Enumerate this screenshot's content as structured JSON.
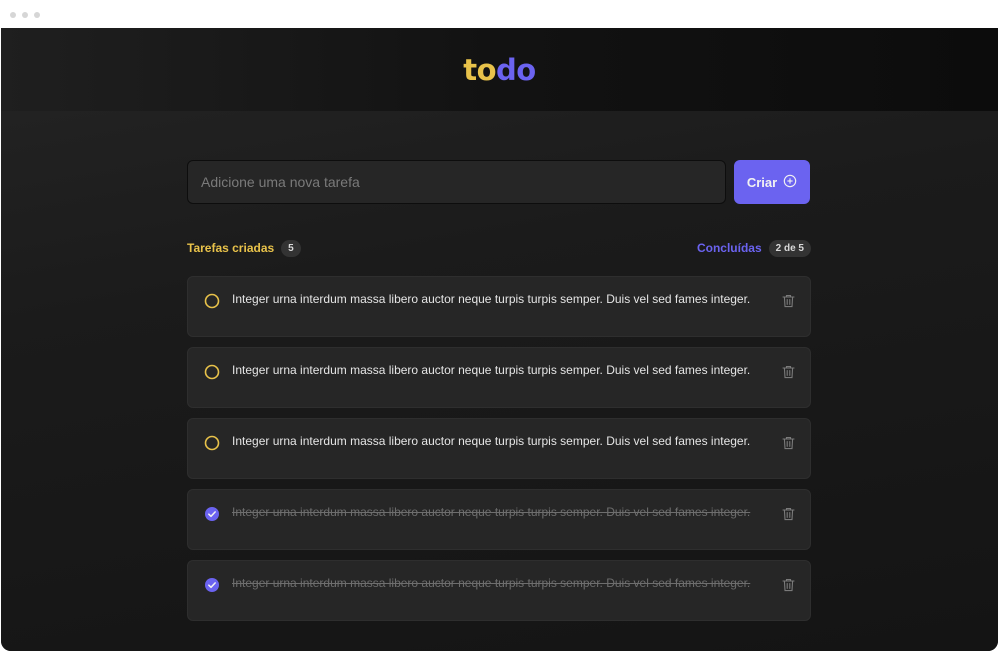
{
  "header": {
    "logo_part1": "to",
    "logo_part2": "do"
  },
  "form": {
    "placeholder": "Adicione uma nova tarefa",
    "button_label": "Criar"
  },
  "info": {
    "created_label": "Tarefas criadas",
    "created_count": "5",
    "done_label": "Concluídas",
    "done_count": "2 de 5"
  },
  "tasks": [
    {
      "text": "Integer urna interdum massa libero auctor neque turpis turpis semper. Duis vel sed fames integer.",
      "done": false
    },
    {
      "text": "Integer urna interdum massa libero auctor neque turpis turpis semper. Duis vel sed fames integer.",
      "done": false
    },
    {
      "text": "Integer urna interdum massa libero auctor neque turpis turpis semper. Duis vel sed fames integer.",
      "done": false
    },
    {
      "text": "Integer urna interdum massa libero auctor neque turpis turpis semper. Duis vel sed fames integer.",
      "done": true
    },
    {
      "text": "Integer urna interdum massa libero auctor neque turpis turpis semper. Duis vel sed fames integer.",
      "done": true
    }
  ],
  "icons": {
    "unchecked": "circle-outline-icon",
    "checked": "check-circle-icon",
    "delete": "trash-icon",
    "add": "plus-circle-icon"
  },
  "colors": {
    "yellow": "#e8c24a",
    "purple": "#6b63f0",
    "background": "#191919",
    "card": "#262626"
  }
}
